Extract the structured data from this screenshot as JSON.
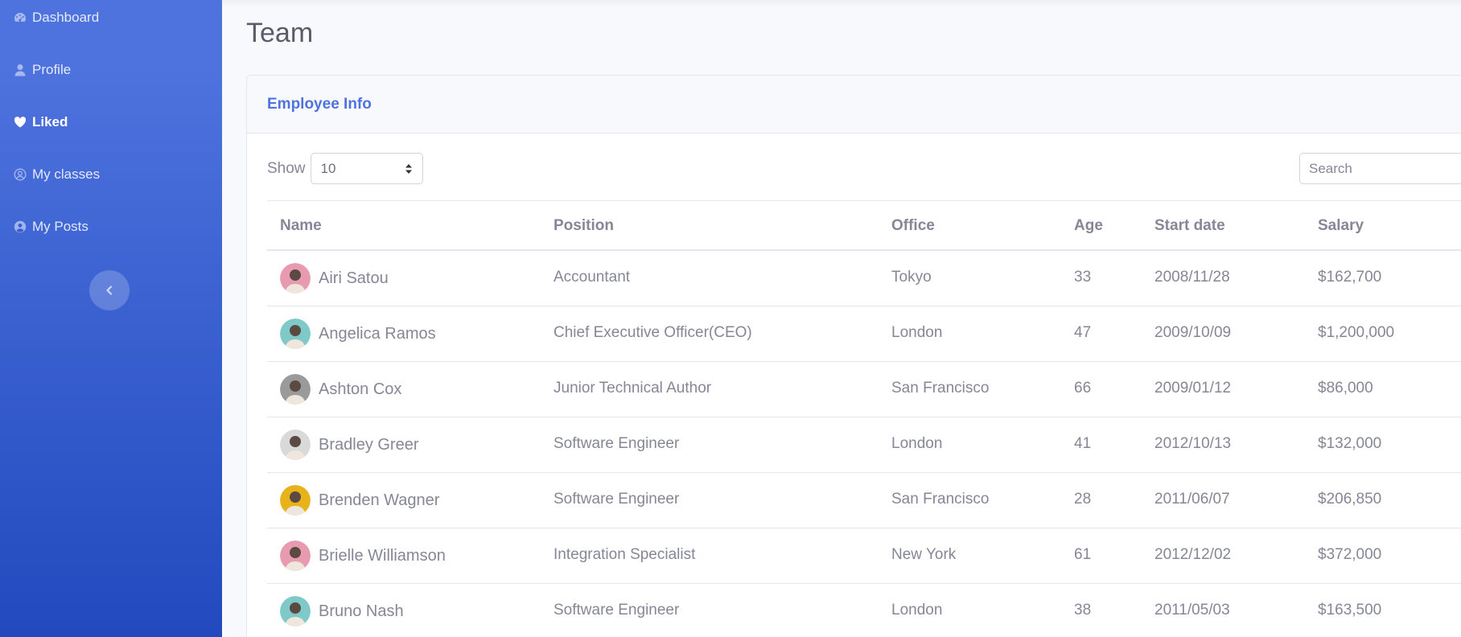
{
  "sidebar": {
    "items": [
      {
        "label": "Dashboard",
        "icon": "dashboard-gauge-icon",
        "active": false
      },
      {
        "label": "Profile",
        "icon": "user-icon",
        "active": false
      },
      {
        "label": "Liked",
        "icon": "heart-icon",
        "active": true
      },
      {
        "label": "My classes",
        "icon": "user-circle-icon",
        "active": false
      },
      {
        "label": "My Posts",
        "icon": "user-circle-solid-icon",
        "active": false
      }
    ],
    "toggle_icon": "chevron-left-icon"
  },
  "page": {
    "title": "Team"
  },
  "card": {
    "title": "Employee Info",
    "show_label": "Show",
    "page_size": "10",
    "search_placeholder": "Search"
  },
  "table": {
    "columns": [
      "Name",
      "Position",
      "Office",
      "Age",
      "Start date",
      "Salary"
    ],
    "rows": [
      {
        "name": "Airi Satou",
        "position": "Accountant",
        "office": "Tokyo",
        "age": "33",
        "start": "2008/11/28",
        "salary": "$162,700",
        "avatar_color": "#e89bb0"
      },
      {
        "name": "Angelica Ramos",
        "position": "Chief Executive Officer(CEO)",
        "office": "London",
        "age": "47",
        "start": "2009/10/09",
        "salary": "$1,200,000",
        "avatar_color": "#7fc9c9"
      },
      {
        "name": "Ashton Cox",
        "position": "Junior Technical Author",
        "office": "San Francisco",
        "age": "66",
        "start": "2009/01/12",
        "salary": "$86,000",
        "avatar_color": "#9a9a9a"
      },
      {
        "name": "Bradley Greer",
        "position": "Software Engineer",
        "office": "London",
        "age": "41",
        "start": "2012/10/13",
        "salary": "$132,000",
        "avatar_color": "#d9d9d9"
      },
      {
        "name": "Brenden Wagner",
        "position": "Software Engineer",
        "office": "San Francisco",
        "age": "28",
        "start": "2011/06/07",
        "salary": "$206,850",
        "avatar_color": "#e8b21a"
      },
      {
        "name": "Brielle Williamson",
        "position": "Integration Specialist",
        "office": "New York",
        "age": "61",
        "start": "2012/12/02",
        "salary": "$372,000",
        "avatar_color": "#e89bb0"
      },
      {
        "name": "Bruno Nash",
        "position": "Software Engineer",
        "office": "London",
        "age": "38",
        "start": "2011/05/03",
        "salary": "$163,500",
        "avatar_color": "#7fc9c9"
      }
    ]
  },
  "colors": {
    "primary": "#4e73df",
    "sidebar_bottom": "#224abe",
    "text_muted": "#858796"
  }
}
